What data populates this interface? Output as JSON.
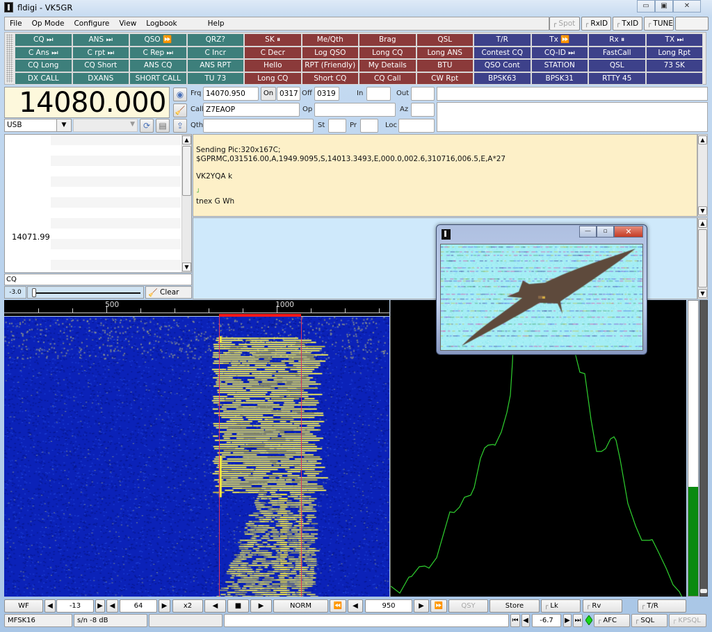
{
  "window": {
    "title": "fldigi - VK5GR",
    "controls": {
      "minimize": "▭",
      "maximize": "▣",
      "close": "✕"
    }
  },
  "menu": {
    "items": [
      "File",
      "Op Mode",
      "Configure",
      "View",
      "Logbook"
    ],
    "help": "Help"
  },
  "top_toggles": {
    "spot": "Spot",
    "rxid": "RxID",
    "txid": "TxID",
    "tune": "TUNE"
  },
  "macros": {
    "colors": {
      "teal": "#3d7f7b",
      "red": "#8b3a3a",
      "blue": "#3d418a"
    },
    "rows": [
      [
        "CQ ⏭",
        "ANS ⏭",
        "QSO ⏩",
        "QRZ?",
        "SK ⏸",
        "Me/Qth",
        "Brag",
        "QSL",
        "T/R",
        "Tx ⏩",
        "Rx ⏸",
        "TX ⏭"
      ],
      [
        "C Ans ⏭",
        "C rpt ⏭",
        "C Rep ⏭",
        "C Incr",
        "C Decr",
        "Log QSO",
        "Long CQ",
        "Long ANS",
        "Contest CQ",
        "CQ-ID ⏭",
        "FastCall",
        "Long Rpt"
      ],
      [
        "CQ Long",
        "CQ Short",
        "ANS CQ",
        "ANS RPT",
        "Hello",
        "RPT (Friendly)",
        "My Details",
        "BTU",
        "QSO Cont",
        "STATION",
        "QSL",
        "73 SK"
      ],
      [
        "DX CALL",
        "DXANS",
        "SHORT CALL",
        "TU 73",
        "Long CQ",
        "Short CQ",
        "CQ Call",
        "CW Rpt",
        "BPSK63",
        "BPSK31",
        "RTTY 45",
        ""
      ]
    ]
  },
  "rig": {
    "frequency": "14080.000",
    "mode": "USB",
    "bandwidth": ""
  },
  "log": {
    "frq_label": "Frq",
    "frq": "14070.950",
    "on_label": "On",
    "on_time": "0317",
    "off_label": "Off",
    "off_time": "0319",
    "in_label": "In",
    "in": "",
    "out_label": "Out",
    "out": "",
    "call_label": "Call",
    "call": "Z7EAOP",
    "op_label": "Op",
    "op": "",
    "az_label": "Az",
    "az": "",
    "qth_label": "Qth",
    "qth": "",
    "st_label": "St",
    "st": "",
    "pr_label": "Pr",
    "pr": "",
    "loc_label": "Loc",
    "loc": ""
  },
  "browser": {
    "frequency_label": "14071.99",
    "search": "CQ",
    "squelch_value": "-3.0",
    "squelch_level_pct": 2,
    "clear_label": "Clear"
  },
  "rx_text": {
    "lines": [
      "Sending Pic:320x167C;",
      "$GPRMC,031516.00,A,1949.9095,S,14013.3493,E,000.0,002.6,310716,006.5,E,A*27",
      "",
      "VK2YQA k",
      "",
      "˩",
      " tnex G Wh"
    ]
  },
  "picture_window": {
    "title": "",
    "content": "received MFSK image of a soaring bird on light blue sky with noise streaks",
    "controls": {
      "minimize": "—",
      "maximize": "▫",
      "close": "✕"
    }
  },
  "waterfall": {
    "scale_labels": [
      {
        "hz": 500,
        "label": "500"
      },
      {
        "hz": 1000,
        "label": "1000"
      }
    ],
    "range_hz": [
      200,
      1330
    ],
    "cursor_low_hz": 830,
    "cursor_high_hz": 1070,
    "colors": {
      "background": "#0b22b8",
      "signal": "#e8e35a",
      "cursor": "#e0305a",
      "bandwidth_bar": "#ff1a1a"
    }
  },
  "spectrum": {
    "trace_color": "#2fd12f",
    "signal_level_pct": 37
  },
  "controls": {
    "wf_mode": "WF",
    "ref_level": "-13",
    "range": "64",
    "zoom": "x2",
    "pause_icon": "■",
    "speed": "NORM",
    "carrier_hz": "950",
    "qsy": "QSY",
    "store": "Store",
    "lk": "Lk",
    "rv": "Rv",
    "tr": "T/R"
  },
  "status": {
    "mode": "MFSK16",
    "snr": "s/n  -8 dB",
    "imd": "",
    "message": "",
    "afc_offset": "-6.7",
    "afc": "AFC",
    "sql": "SQL",
    "kpsql": "KPSQL"
  }
}
